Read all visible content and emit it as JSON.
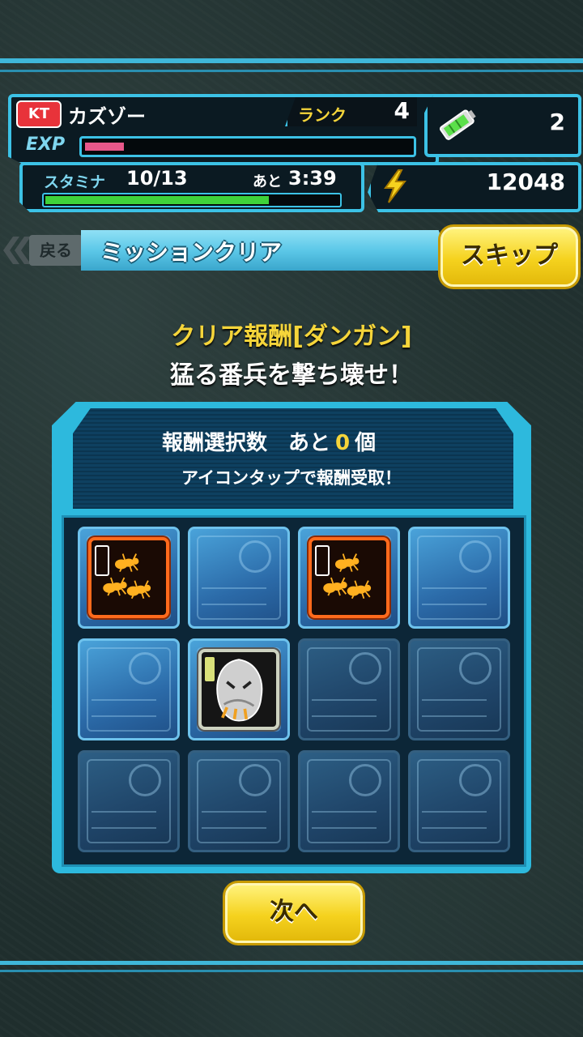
{
  "player": {
    "badge": "KT",
    "name": "カズゾー",
    "rank_label": "ランク",
    "rank_value": "4",
    "exp_label": "EXP",
    "exp_fraction": 0.12
  },
  "items": {
    "count": "2"
  },
  "stamina": {
    "label": "スタミナ",
    "value": "10/13",
    "time_label": "あと",
    "time": "3:39",
    "fraction": 0.77
  },
  "coins": {
    "value": "12048"
  },
  "nav": {
    "back_label": "戻る",
    "title": "ミッションクリア",
    "skip_label": "スキップ"
  },
  "reward": {
    "heading": "クリア報酬[ダンガン]",
    "subheading": "猛る番兵を撃ち壊せ！",
    "select_label": "報酬選択数　あと",
    "select_count": "0",
    "select_unit": "個",
    "instruction": "アイコンタップで報酬受取！"
  },
  "grid": {
    "rows": [
      [
        "ant-reward",
        "empty",
        "ant-reward",
        "empty"
      ],
      [
        "empty",
        "character-reward",
        "locked",
        "locked"
      ],
      [
        "locked",
        "locked",
        "locked",
        "locked"
      ]
    ]
  },
  "next_label": "次へ",
  "colors": {
    "accent": "#3cc2e6",
    "button": "#f5d21e",
    "exp_fill": "#e8588a",
    "stamina_fill": "#3fd23a",
    "highlight_text": "#f5d53a"
  }
}
